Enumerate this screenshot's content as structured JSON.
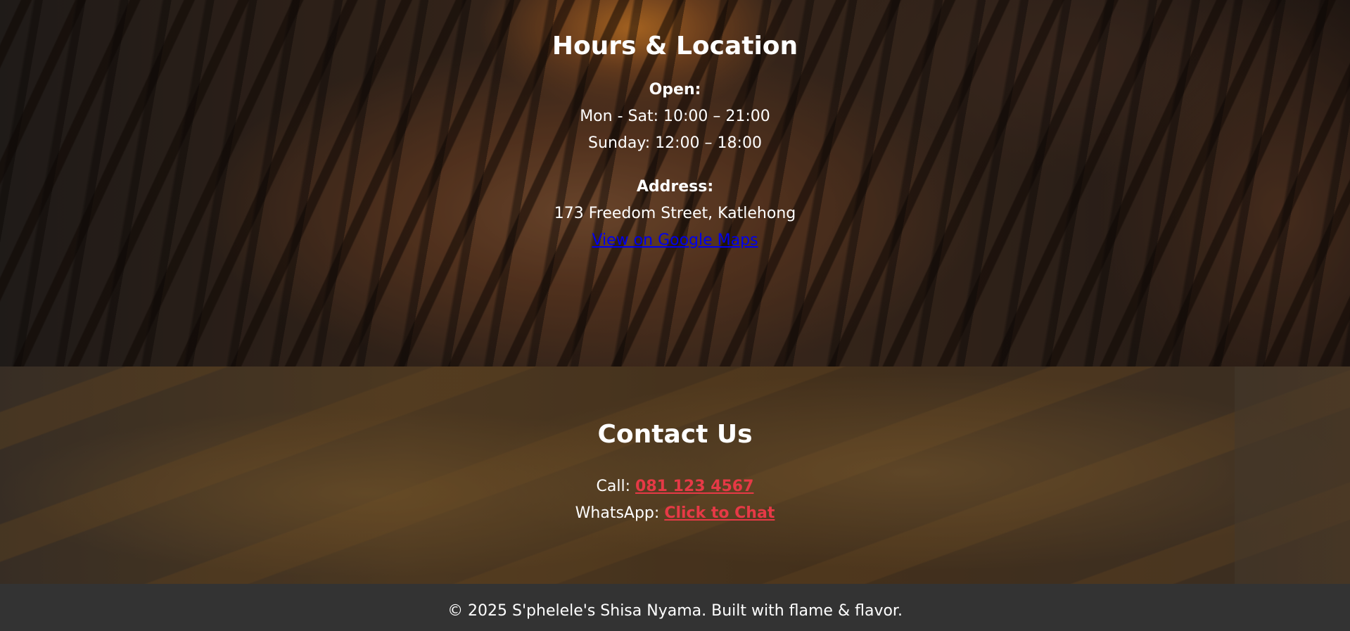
{
  "hours_location": {
    "title": "Hours & Location",
    "open_label": "Open:",
    "weekday_hours": "Mon - Sat: 10:00 – 21:00",
    "sunday_hours": "Sunday: 12:00 – 18:00",
    "address_label": "Address:",
    "address": "173 Freedom Street, Katlehong",
    "maps_link": "View on Google Maps"
  },
  "contact": {
    "title": "Contact Us",
    "call_label": "Call: ",
    "phone": "081 123 4567",
    "whatsapp_label": "WhatsApp: ",
    "whatsapp_link": "Click to Chat"
  },
  "footer": {
    "copyright": "© 2025 S'phelele's Shisa Nyama. Built with flame & flavor."
  },
  "colors": {
    "link_red": "#e63946",
    "link_blue": "#0000ee",
    "footer_bg": "#333333"
  }
}
